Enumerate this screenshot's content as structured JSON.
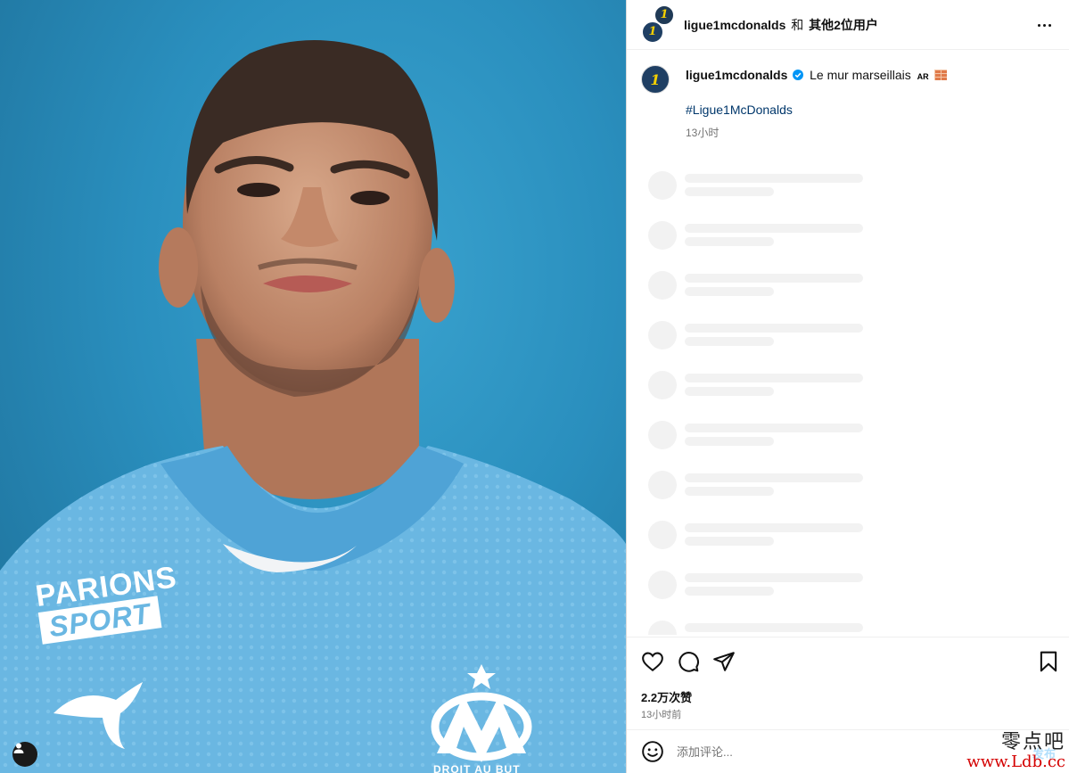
{
  "post": {
    "header": {
      "username": "ligue1mcdonalds",
      "joiner": "和",
      "others": "其他2位用户"
    },
    "caption": {
      "username": "ligue1mcdonalds",
      "text": "Le mur marseillais",
      "ar_label": "AR",
      "emoji": "brick-emoji",
      "hashtag": "#Ligue1McDonalds",
      "time": "13小时"
    },
    "image": {
      "jersey_sponsor_line1": "PARIONS",
      "jersey_sponsor_line2": "SPORT",
      "crest_text": "DROIT AU BUT",
      "background_color": "#2a8fbe",
      "jersey_color": "#6ab7e2"
    },
    "likes": "2.2万次赞",
    "posted_time": "13小时前",
    "comment": {
      "placeholder": "添加评论...",
      "value": "",
      "post_label": "发布"
    },
    "comment_skeleton_rows": 10
  },
  "icons": {
    "like": "heart-icon",
    "comment": "comment-icon",
    "share": "send-icon",
    "save": "bookmark-icon",
    "emoji": "emoji-icon",
    "more": "more-options-icon",
    "user_tag": "user-tag-icon",
    "verified": "verified-badge-icon"
  },
  "watermark": {
    "line1": "零点吧",
    "line2": "www.Ldb.cc"
  }
}
